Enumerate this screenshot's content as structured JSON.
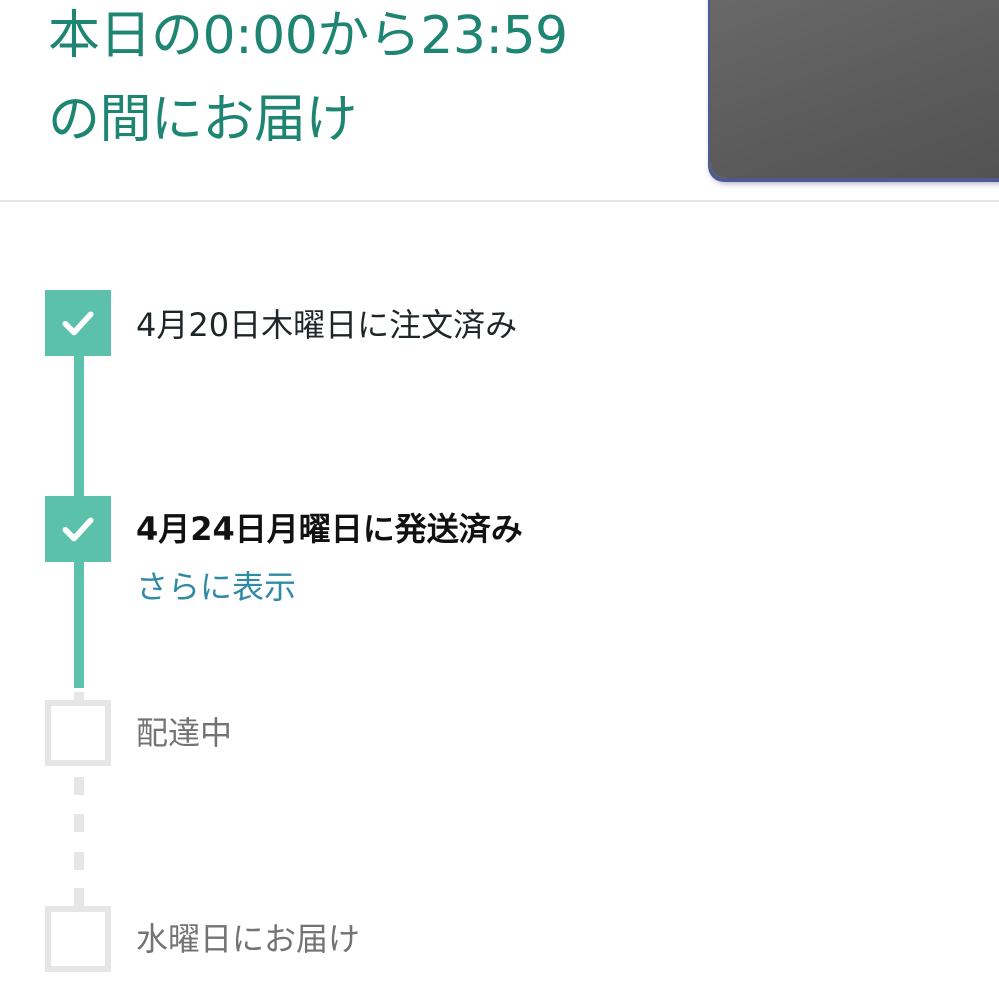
{
  "header": {
    "delivery_window_line1": "本日の0:00から23:59",
    "delivery_window_line2": "の間にお届け"
  },
  "tracker": {
    "steps": [
      {
        "label": "4月20日木曜日に注文済み",
        "status": "done"
      },
      {
        "label": "4月24日月曜日に発送済み",
        "status": "done",
        "link": "さらに表示"
      },
      {
        "label": "配達中",
        "status": "pending"
      },
      {
        "label": "水曜日にお届け",
        "status": "pending"
      }
    ]
  },
  "colors": {
    "accent": "#1d8571",
    "progress": "#5bc1ab",
    "link": "#2f8ba3",
    "pending_box": "#e6e6e6"
  }
}
